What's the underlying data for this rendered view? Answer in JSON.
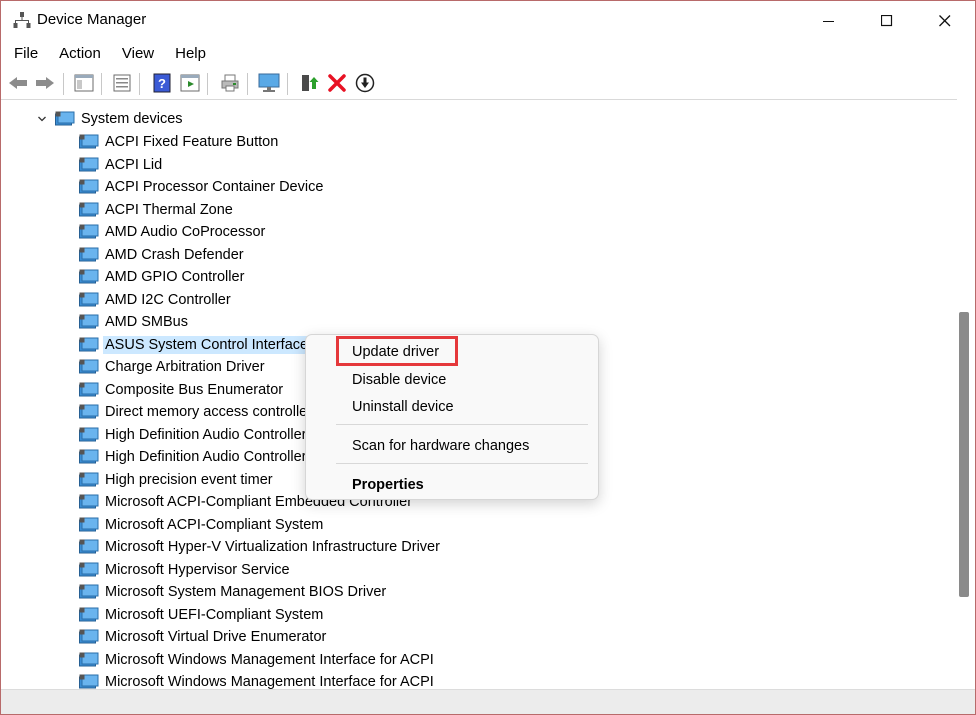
{
  "window": {
    "title": "Device Manager",
    "icon": "device-manager-icon",
    "controls": {
      "minimize": "minimize-icon",
      "maximize": "maximize-icon",
      "close": "close-icon"
    }
  },
  "menu": [
    "File",
    "Action",
    "View",
    "Help"
  ],
  "toolbar_icons": [
    "back-arrow-icon",
    "forward-arrow-icon",
    "show-hide-console-tree-icon",
    "properties-sheet-icon",
    "help-icon",
    "action-pane-icon",
    "print-icon",
    "computer-monitor-icon",
    "update-driver-icon",
    "uninstall-device-icon",
    "disable-device-icon"
  ],
  "colors": {
    "selection": "#cce8ff",
    "highlight_box": "#e5383b",
    "uninstall_x": "#e81123",
    "update_green": "#2ca02c"
  },
  "tree": {
    "category": "System devices",
    "selected_device": "ASUS System Control Interface",
    "devices": [
      "ACPI Fixed Feature Button",
      "ACPI Lid",
      "ACPI Processor Container Device",
      "ACPI Thermal Zone",
      "AMD Audio CoProcessor",
      "AMD Crash Defender",
      "AMD GPIO Controller",
      "AMD I2C Controller",
      "AMD SMBus",
      "ASUS System Control Interface",
      "Charge Arbitration Driver",
      "Composite Bus Enumerator",
      "Direct memory access controller",
      "High Definition Audio Controller",
      "High Definition Audio Controller",
      "High precision event timer",
      "Microsoft ACPI-Compliant Embedded Controller",
      "Microsoft ACPI-Compliant System",
      "Microsoft Hyper-V Virtualization Infrastructure Driver",
      "Microsoft Hypervisor Service",
      "Microsoft System Management BIOS Driver",
      "Microsoft UEFI-Compliant System",
      "Microsoft Virtual Drive Enumerator",
      "Microsoft Windows Management Interface for ACPI",
      "Microsoft Windows Management Interface for ACPI"
    ]
  },
  "context_menu": {
    "update_driver": "Update driver",
    "disable_device": "Disable device",
    "uninstall_device": "Uninstall device",
    "scan": "Scan for hardware changes",
    "properties": "Properties"
  }
}
